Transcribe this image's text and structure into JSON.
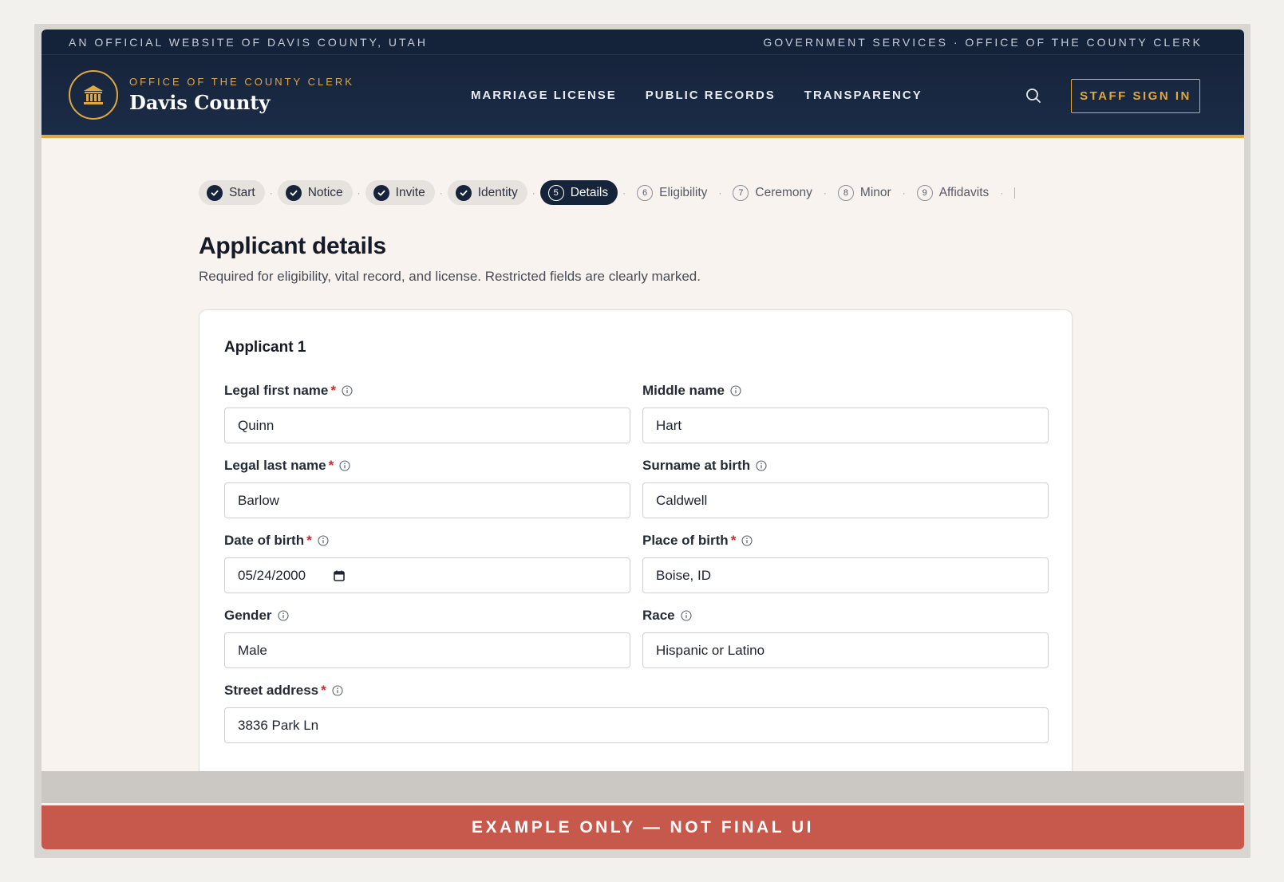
{
  "util_bar": {
    "left": "AN OFFICIAL WEBSITE OF DAVIS COUNTY, UTAH",
    "right": "GOVERNMENT SERVICES · OFFICE OF THE COUNTY CLERK"
  },
  "header": {
    "brand_sub": "OFFICE OF THE COUNTY CLERK",
    "brand_name": "Davis County",
    "nav": [
      "MARRIAGE LICENSE",
      "PUBLIC RECORDS",
      "TRANSPARENCY"
    ],
    "staff_btn": "STAFF SIGN IN"
  },
  "steps": [
    {
      "label": "Start",
      "state": "done"
    },
    {
      "label": "Notice",
      "state": "done"
    },
    {
      "label": "Invite",
      "state": "done"
    },
    {
      "label": "Identity",
      "state": "done"
    },
    {
      "label": "Details",
      "state": "active",
      "num": "5"
    },
    {
      "label": "Eligibility",
      "state": "todo",
      "num": "6"
    },
    {
      "label": "Ceremony",
      "state": "todo",
      "num": "7"
    },
    {
      "label": "Minor",
      "state": "todo",
      "num": "8"
    },
    {
      "label": "Affidavits",
      "state": "todo",
      "num": "9"
    }
  ],
  "page": {
    "title": "Applicant details",
    "description": "Required for eligibility, vital record, and license. Restricted fields are clearly marked."
  },
  "card": {
    "title": "Applicant 1",
    "fields": {
      "first_name": {
        "label": "Legal first name",
        "value": "Quinn"
      },
      "middle_name": {
        "label": "Middle name",
        "value": "Hart"
      },
      "last_name": {
        "label": "Legal last name",
        "value": "Barlow"
      },
      "surname_birth": {
        "label": "Surname at birth",
        "value": "Caldwell"
      },
      "dob": {
        "label": "Date of birth",
        "value": "05/24/2000"
      },
      "pob": {
        "label": "Place of birth",
        "value": "Boise, ID"
      },
      "gender": {
        "label": "Gender",
        "value": "Male"
      },
      "race": {
        "label": "Race",
        "value": "Hispanic or Latino"
      },
      "street": {
        "label": "Street address",
        "value": "3836 Park Ln"
      }
    }
  },
  "banner": "EXAMPLE ONLY — NOT FINAL UI",
  "colors": {
    "navy": "#16243b",
    "gold": "#e0a83f",
    "banner_red": "#c6584c",
    "required": "#c62d2d"
  }
}
